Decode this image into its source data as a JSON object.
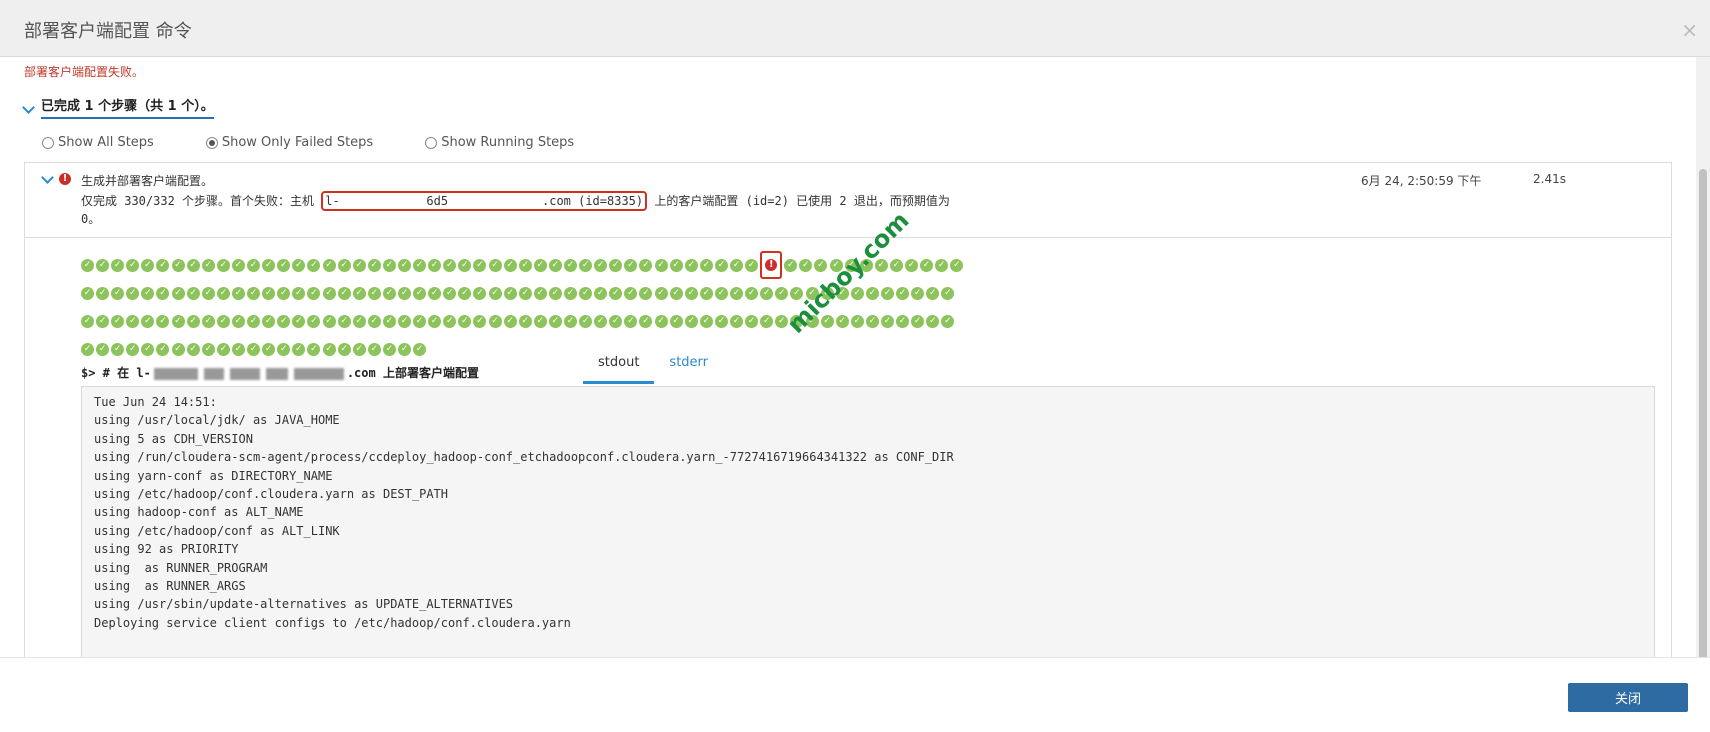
{
  "header": {
    "title": "部署客户端配置 命令",
    "close_label": "×"
  },
  "status": {
    "error_message": "部署客户端配置失败。",
    "summary": "已完成 1 个步骤（共 1 个）。"
  },
  "filters": {
    "options": [
      "Show All Steps",
      "Show Only Failed Steps",
      "Show Running Steps"
    ],
    "selected": "Show Only Failed Steps"
  },
  "step": {
    "title": "生成并部署客户端配置。",
    "time": "6月 24, 2:50:59 下午",
    "duration": "2.41s",
    "detail_prefix": "仅完成 330/332 个步骤。首个失败：主机 ",
    "detail_host": "l-            6d5             .com (id=8335)",
    "detail_suffix_1": " 上的客户端配置 (id=2) 已使用 2 退出，而预期值为",
    "detail_suffix_2": "0。"
  },
  "host_grid": {
    "rows": [
      {
        "ok_before": 45,
        "failed": 1,
        "ok_after": 12
      },
      {
        "ok_before": 58,
        "failed": 0,
        "ok_after": 0
      },
      {
        "ok_before": 58,
        "failed": 0,
        "ok_after": 0
      },
      {
        "ok_before": 23,
        "failed": 0,
        "ok_after": 0
      }
    ],
    "ok_color": "#8cc35b",
    "fail_color": "#c9302c"
  },
  "command": {
    "prefix": "$> # 在 l-",
    "host_tail": ".com",
    "suffix": " 上部署客户端配置"
  },
  "tabs": [
    {
      "label": "stdout",
      "active": true
    },
    {
      "label": "stderr",
      "active": false
    }
  ],
  "watermark": "micboy.com",
  "stdout_lines": [
    "Tue Jun 24 14:51:",
    "using /usr/local/jdk/ as JAVA_HOME",
    "using 5 as CDH_VERSION",
    "using /run/cloudera-scm-agent/process/ccdeploy_hadoop-conf_etchadoopconf.cloudera.yarn_-7727416719664341322 as CONF_DIR",
    "using yarn-conf as DIRECTORY_NAME",
    "using /etc/hadoop/conf.cloudera.yarn as DEST_PATH",
    "using hadoop-conf as ALT_NAME",
    "using /etc/hadoop/conf as ALT_LINK",
    "using 92 as PRIORITY",
    "using  as RUNNER_PROGRAM",
    "using  as RUNNER_ARGS",
    "using /usr/sbin/update-alternatives as UPDATE_ALTERNATIVES",
    "Deploying service client configs to /etc/hadoop/conf.cloudera.yarn"
  ],
  "footer": {
    "close_button": "关闭"
  }
}
